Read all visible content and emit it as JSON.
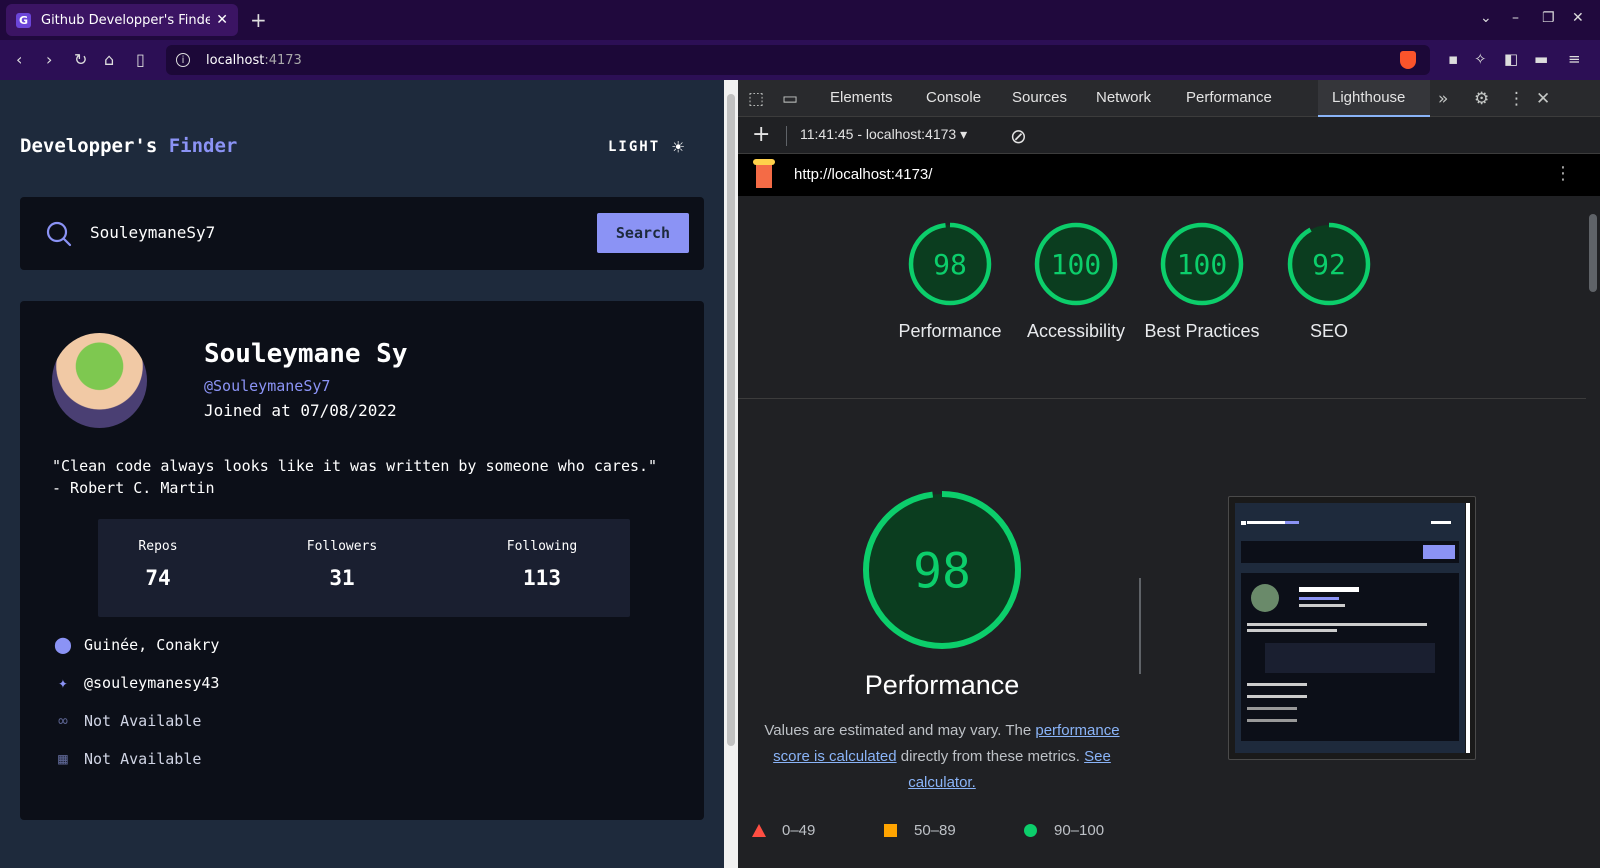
{
  "browser": {
    "tab_title": "Github Developper's Finder",
    "tab_favicon": "G",
    "url_host": "localhost",
    "url_port": ":4173"
  },
  "app": {
    "title_part1": "Developper's ",
    "title_part2": "Finder",
    "theme_label": "LIGHT",
    "accent_color": "#8b93f5"
  },
  "search": {
    "value": "SouleymaneSy7",
    "button_label": "Search"
  },
  "profile": {
    "name": "Souleymane Sy",
    "login": "@SouleymaneSy7",
    "joined": "Joined at 07/08/2022",
    "bio": "\"Clean code always looks like it was written by someone who cares.\" - Robert C. Martin",
    "stats": [
      {
        "label": "Repos",
        "value": "74"
      },
      {
        "label": "Followers",
        "value": "31"
      },
      {
        "label": "Following",
        "value": "113"
      }
    ],
    "location": "Guinée, Conakry",
    "twitter": "@souleymanesy43",
    "website": "Not Available",
    "company": "Not Available"
  },
  "devtools": {
    "tabs": [
      "Elements",
      "Console",
      "Sources",
      "Network",
      "Performance",
      "Lighthouse"
    ],
    "active_tab": "Lighthouse",
    "report_label": "11:41:45 - localhost:4173",
    "lighthouse_url": "http://localhost:4173/",
    "scores": [
      {
        "label": "Performance",
        "score": 98
      },
      {
        "label": "Accessibility",
        "score": 100
      },
      {
        "label": "Best Practices",
        "score": 100
      },
      {
        "label": "SEO",
        "score": 92
      }
    ],
    "big_score": 98,
    "big_label": "Performance",
    "desc_text1": "Values are estimated and may vary. The ",
    "desc_link1": "performance score is calculated",
    "desc_text2": " directly from these metrics. ",
    "desc_link2": "See calculator.",
    "legend": [
      "0–49",
      "50–89",
      "90–100"
    ],
    "score_color": "#0cce6b",
    "score_bg": "#0b3d1f"
  }
}
